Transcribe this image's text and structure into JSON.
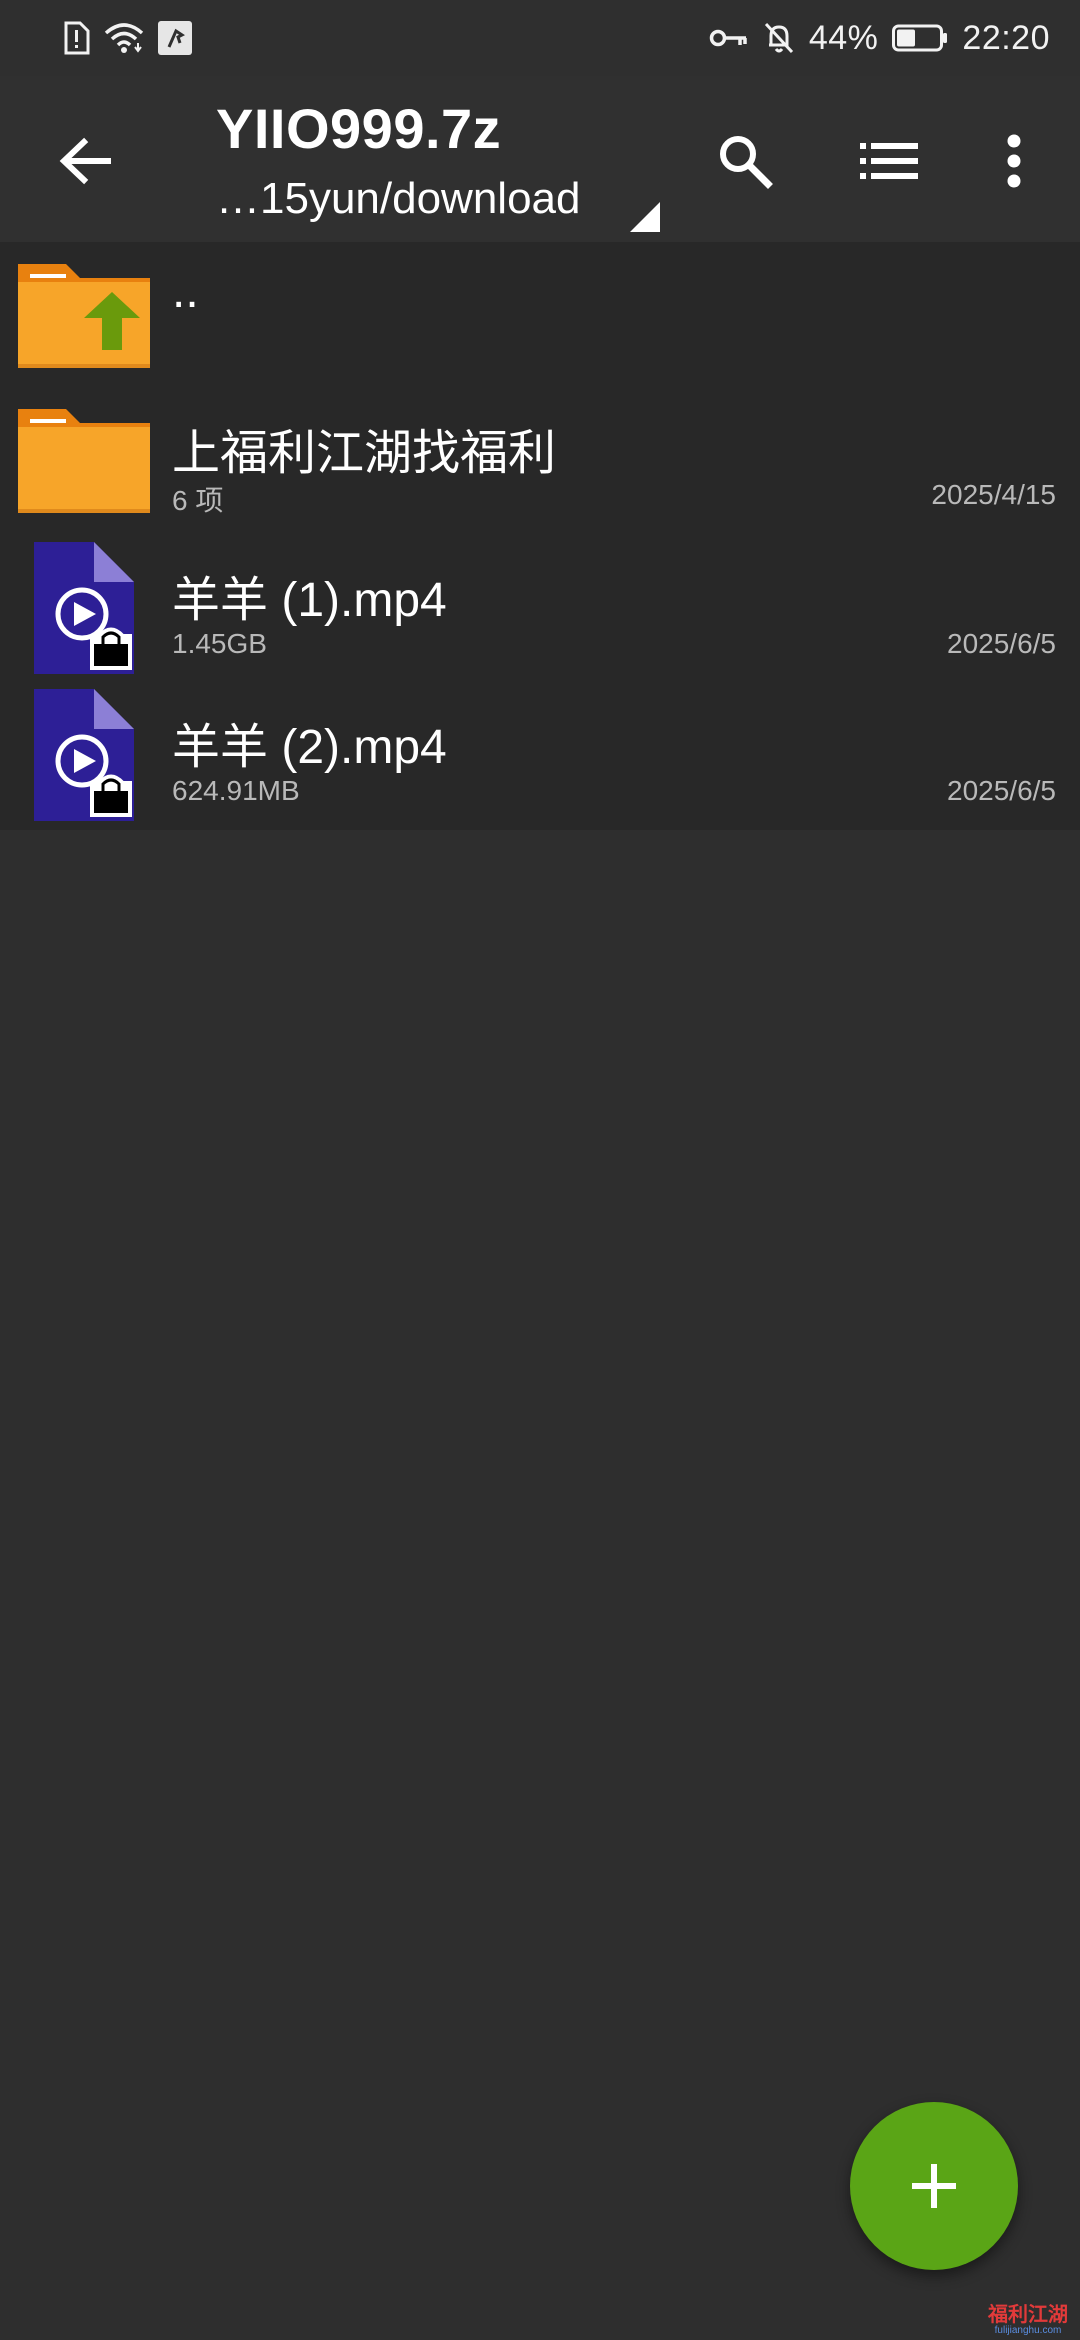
{
  "status_bar": {
    "battery_percent": "44%",
    "battery_level": 0.44,
    "time": "22:20",
    "left_icons": [
      "sim-alert-icon",
      "wifi-icon",
      "app-notification-icon"
    ],
    "right_icons": [
      "vpn-key-icon",
      "bell-off-icon",
      "battery-icon"
    ]
  },
  "toolbar": {
    "title": "YIIO999.7z",
    "subtitle": "…15yun/download",
    "icons": [
      "back-arrow-icon",
      "dropdown-triangle-icon",
      "search-icon",
      "list-view-icon",
      "more-vert-icon"
    ]
  },
  "files": [
    {
      "name": "..",
      "type": "parent-folder",
      "meta": "",
      "date": ""
    },
    {
      "name": "上福利江湖找福利",
      "type": "folder",
      "meta": "6 项",
      "date": "2025/4/15"
    },
    {
      "name": "羊羊 (1).mp4",
      "type": "video-locked",
      "meta": "1.45GB",
      "date": "2025/6/5"
    },
    {
      "name": "羊羊 (2).mp4",
      "type": "video-locked",
      "meta": "624.91MB",
      "date": "2025/6/5"
    }
  ],
  "fab": {
    "icon": "plus-icon",
    "color": "#5aa516"
  },
  "watermark": {
    "text_top": "福利江湖",
    "text_bottom": "fulijianghu.com"
  },
  "colors": {
    "background": "#2e2e2e",
    "list_background": "#282828",
    "folder_orange": "#f7a529",
    "folder_tab": "#e8810f",
    "up_arrow_green": "#6a9a0c",
    "video_purple": "#2d1f96",
    "video_fold": "#8c7fd6",
    "fab_green": "#5aa516"
  }
}
